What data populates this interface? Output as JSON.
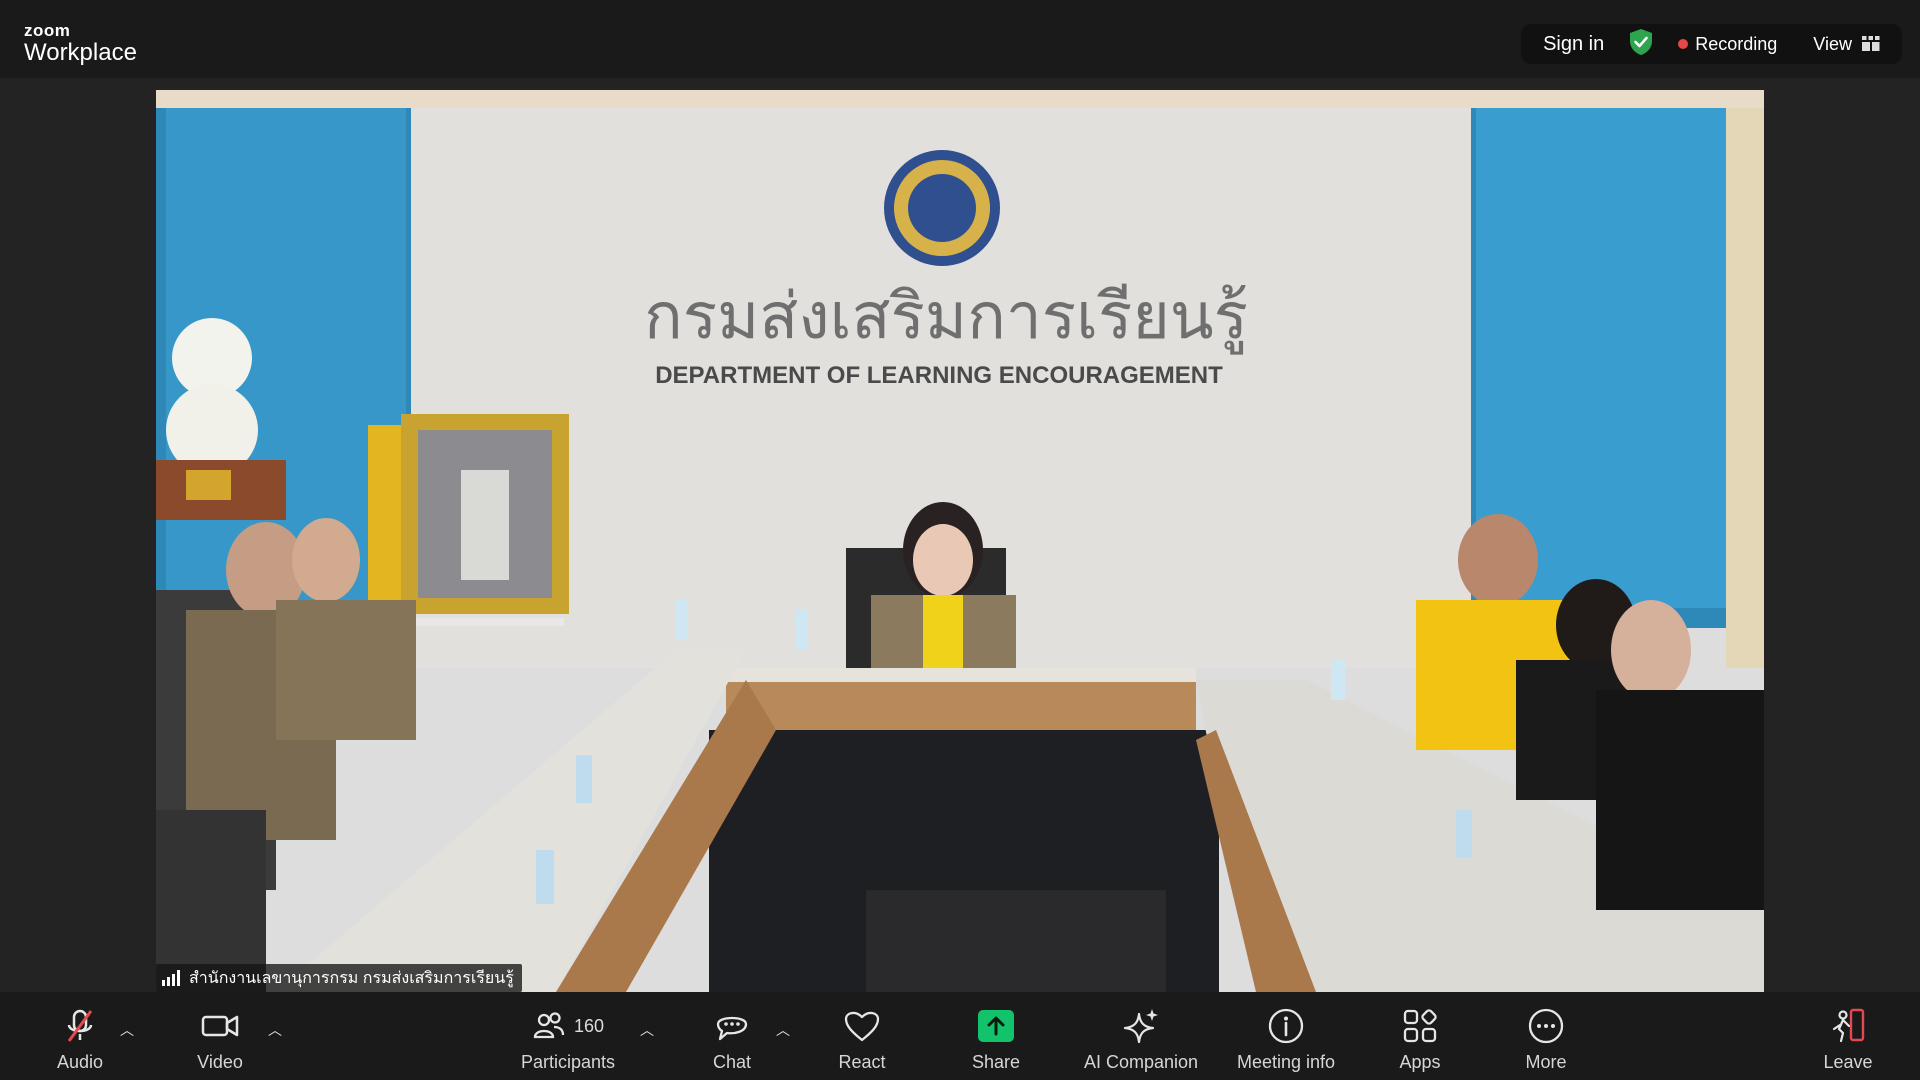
{
  "brand": {
    "line1": "zoom",
    "line2": "Workplace"
  },
  "header": {
    "sign_in": "Sign in",
    "recording": "Recording",
    "view": "View",
    "colors": {
      "shield": "#2ea44f",
      "recording_dot": "#e54848"
    }
  },
  "video": {
    "banner_thai": "กรมส่งเสริมการเรียนรู้",
    "banner_english": "DEPARTMENT OF LEARNING ENCOURAGEMENT",
    "speaker_name": "สำนักงานเลขานุการกรม กรมส่งเสริมการเรียนรู้"
  },
  "toolbar": {
    "audio": "Audio",
    "video": "Video",
    "participants": "Participants",
    "participant_count": "160",
    "chat": "Chat",
    "react": "React",
    "share": "Share",
    "ai_companion": "AI Companion",
    "meeting_info": "Meeting info",
    "apps": "Apps",
    "more": "More",
    "leave": "Leave",
    "colors": {
      "share": "#12c36b",
      "mute_slash": "#e5484d",
      "leave": "#e5484d"
    }
  }
}
